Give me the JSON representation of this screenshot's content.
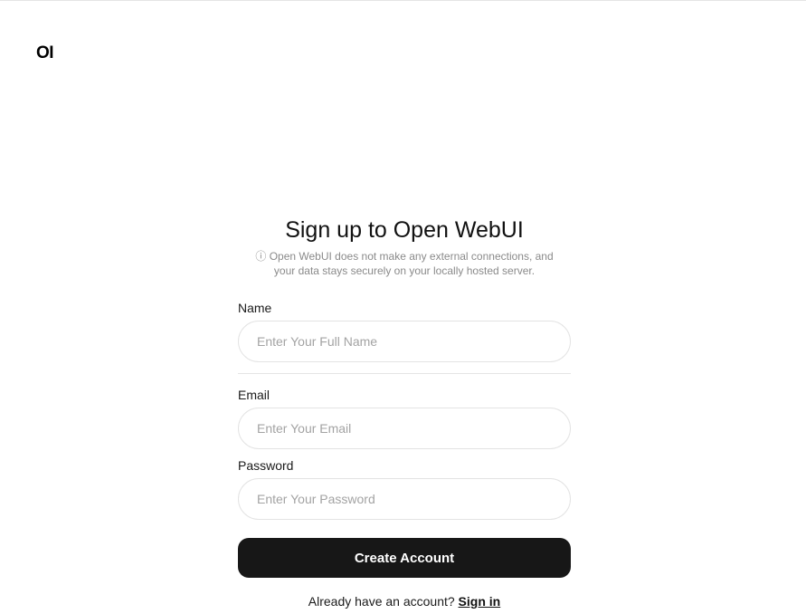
{
  "app": {
    "logo_text": "OI"
  },
  "signup": {
    "title": "Sign up to Open WebUI",
    "notice_icon": "info-icon",
    "notice_icon_glyph": "ⓘ",
    "notice_text": "Open WebUI does not make any external connections, and your data stays securely on your locally hosted server.",
    "name_label": "Name",
    "name_placeholder": "Enter Your Full Name",
    "email_label": "Email",
    "email_placeholder": "Enter Your Email",
    "password_label": "Password",
    "password_placeholder": "Enter Your Password",
    "submit_label": "Create Account",
    "signin_prompt": "Already have an account?",
    "signin_link": "Sign in"
  },
  "colors": {
    "button_bg": "#171717",
    "button_text": "#ffffff",
    "muted_text": "#8a8a8a",
    "input_border": "#e3e3e3"
  }
}
